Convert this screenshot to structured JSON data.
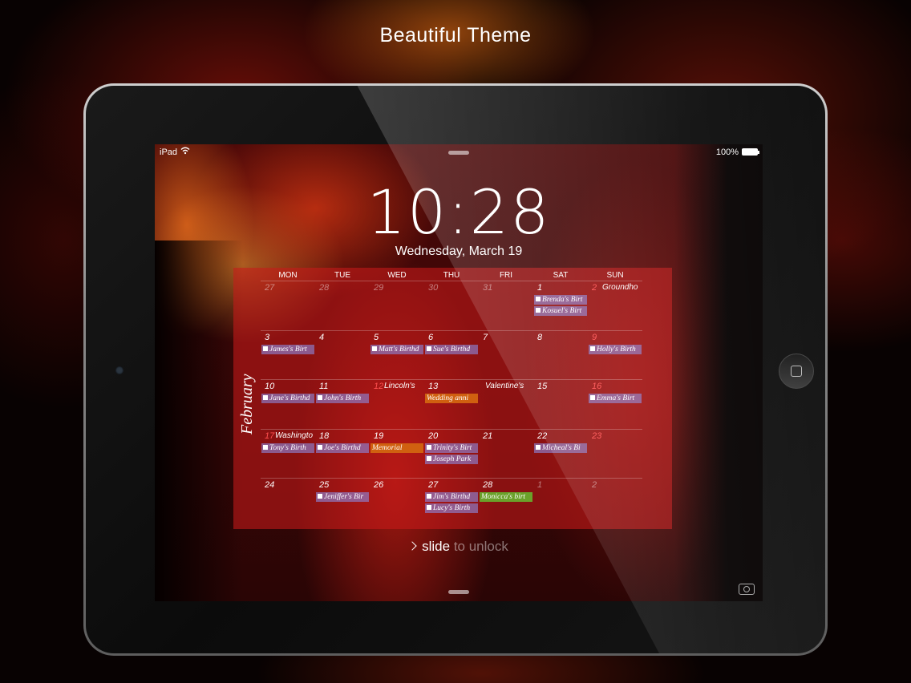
{
  "headline": "Beautiful Theme",
  "status": {
    "carrier": "iPad",
    "battery": "100%"
  },
  "lock": {
    "time": "10:28",
    "date": "Wednesday, March 19",
    "slide_a": "slide",
    "slide_b": " to unlock"
  },
  "calendar": {
    "month": "February",
    "weekdays": [
      "MON",
      "TUE",
      "WED",
      "THU",
      "FRI",
      "SAT",
      "SUN"
    ],
    "weeks": [
      [
        {
          "d": "27",
          "dim": true
        },
        {
          "d": "28",
          "dim": true
        },
        {
          "d": "29",
          "dim": true
        },
        {
          "d": "30",
          "dim": true
        },
        {
          "d": "31",
          "dim": true
        },
        {
          "d": "1",
          "events": [
            {
              "t": "Brenda's Birt",
              "k": "bday"
            },
            {
              "t": "Kosuel's Birt",
              "k": "bday"
            }
          ]
        },
        {
          "d": "2",
          "red": true,
          "holiday": "Groundho"
        }
      ],
      [
        {
          "d": "3",
          "events": [
            {
              "t": "James's Birt",
              "k": "bday"
            }
          ]
        },
        {
          "d": "4"
        },
        {
          "d": "5",
          "events": [
            {
              "t": "Matt's Birthd",
              "k": "bday"
            }
          ]
        },
        {
          "d": "6",
          "events": [
            {
              "t": "Sue's Birthd",
              "k": "bday"
            }
          ]
        },
        {
          "d": "7"
        },
        {
          "d": "8"
        },
        {
          "d": "9",
          "red": true,
          "events": [
            {
              "t": "Holly's Birth",
              "k": "bday"
            }
          ]
        }
      ],
      [
        {
          "d": "10",
          "events": [
            {
              "t": "Jane's Birthd",
              "k": "bday"
            }
          ]
        },
        {
          "d": "11",
          "events": [
            {
              "t": "John's Birth",
              "k": "bday"
            }
          ]
        },
        {
          "d": "12",
          "red": true,
          "holiday": "Lincoln's"
        },
        {
          "d": "13",
          "events": [
            {
              "t": "Wedding anni",
              "k": "orange"
            }
          ]
        },
        {
          "d": "",
          "holiday": "Valentine's"
        },
        {
          "d": "15"
        },
        {
          "d": "16",
          "red": true,
          "events": [
            {
              "t": "Emma's Birt",
              "k": "bday"
            }
          ]
        }
      ],
      [
        {
          "d": "17",
          "red": true,
          "holiday": "Washingto",
          "events": [
            {
              "t": "Tony's Birth",
              "k": "bday"
            }
          ]
        },
        {
          "d": "18",
          "events": [
            {
              "t": "Joe's Birthd",
              "k": "bday"
            }
          ]
        },
        {
          "d": "19",
          "events": [
            {
              "t": "Memorial",
              "k": "orange"
            }
          ]
        },
        {
          "d": "20",
          "events": [
            {
              "t": "Trinity's Birt",
              "k": "bday"
            },
            {
              "t": "Joseph Park",
              "k": "bday"
            }
          ]
        },
        {
          "d": "21"
        },
        {
          "d": "22",
          "events": [
            {
              "t": "Micheal's Bi",
              "k": "bday"
            }
          ]
        },
        {
          "d": "23",
          "red": true
        }
      ],
      [
        {
          "d": "24"
        },
        {
          "d": "25",
          "events": [
            {
              "t": "Jeniffer's Bir",
              "k": "bday"
            }
          ]
        },
        {
          "d": "26"
        },
        {
          "d": "27",
          "events": [
            {
              "t": "Jim's Birthd",
              "k": "bday"
            },
            {
              "t": "Lucy's Birth",
              "k": "bday"
            }
          ]
        },
        {
          "d": "28",
          "events": [
            {
              "t": "Monicca's birt",
              "k": "green"
            }
          ]
        },
        {
          "d": "1",
          "dim": true
        },
        {
          "d": "2",
          "dim": true
        }
      ]
    ]
  }
}
